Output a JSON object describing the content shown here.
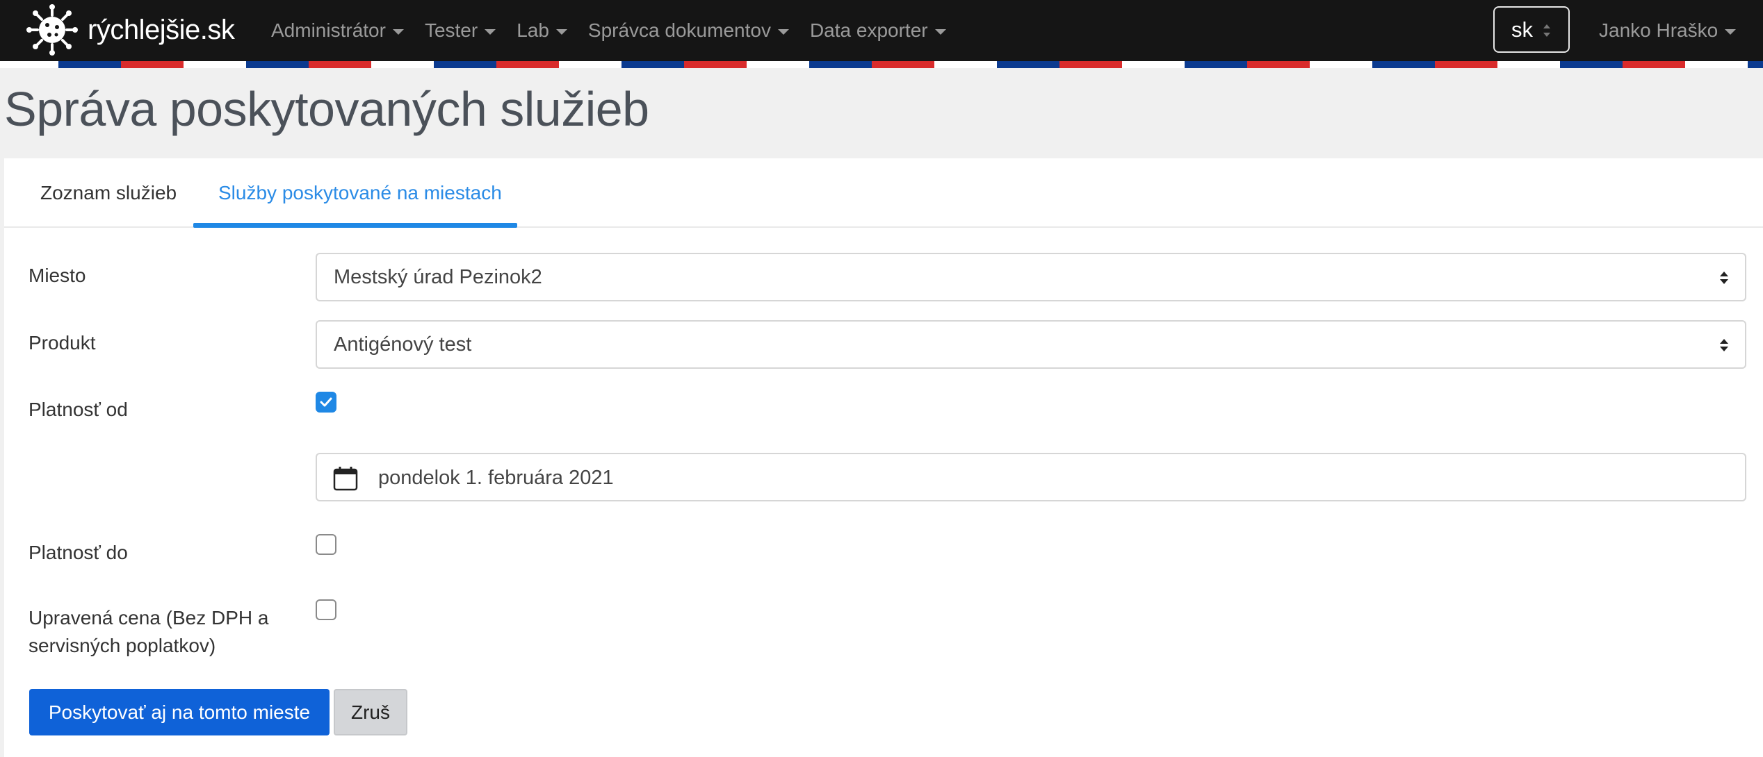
{
  "navbar": {
    "brand": "rýchlejšie.sk",
    "menu": [
      {
        "label": "Administrátor"
      },
      {
        "label": "Tester"
      },
      {
        "label": "Lab"
      },
      {
        "label": "Správca dokumentov"
      },
      {
        "label": "Data exporter"
      }
    ],
    "language": "sk",
    "user": "Janko Hraško"
  },
  "colors": {
    "navbar_bg": "#151515",
    "accent": "#1f88e5",
    "primary_button": "#0f62d8",
    "flag_blue": "#0b3a8f",
    "flag_red": "#d92b2b"
  },
  "page": {
    "title": "Správa poskytovaných služieb"
  },
  "tabs": [
    {
      "label": "Zoznam služieb",
      "active": false
    },
    {
      "label": "Služby poskytované na miestach",
      "active": true
    }
  ],
  "form": {
    "place_label": "Miesto",
    "place_value": "Mestský úrad Pezinok2",
    "product_label": "Produkt",
    "product_value": "Antigénový test",
    "valid_from_label": "Platnosť od",
    "valid_from_checked": true,
    "valid_from_date": "pondelok 1. februára 2021",
    "valid_to_label": "Platnosť do",
    "valid_to_checked": false,
    "price_label_line1": "Upravená cena (Bez DPH a",
    "price_label_line2": "servisných poplatkov)",
    "price_checked": false
  },
  "buttons": {
    "submit": "Poskytovať aj na tomto mieste",
    "cancel": "Zruš"
  }
}
